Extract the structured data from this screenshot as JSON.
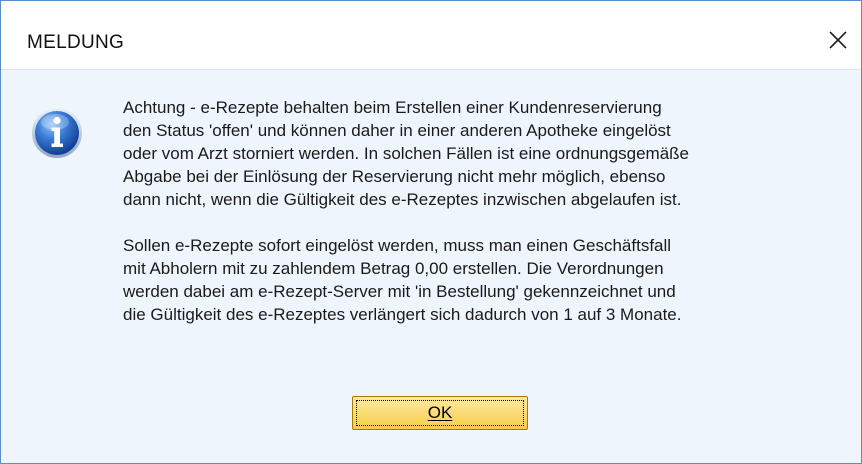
{
  "window": {
    "title": "MELDUNG",
    "close_icon": "close-icon"
  },
  "message": {
    "icon": "info-icon",
    "paragraph1": "Achtung - e-Rezepte behalten beim Erstellen einer Kundenreservierung\nden Status 'offen' und können daher in einer anderen Apotheke eingelöst\noder vom Arzt storniert werden. In solchen Fällen ist eine ordnungsgemäße\nAbgabe bei der Einlösung der Reservierung nicht mehr möglich, ebenso\ndann nicht, wenn die Gültigkeit des e-Rezeptes inzwischen abgelaufen ist.",
    "paragraph2": "Sollen e-Rezepte sofort eingelöst werden, muss man einen Geschäftsfall\nmit Abholern mit zu zahlendem Betrag 0,00 erstellen. Die Verordnungen\nwerden dabei am e-Rezept-Server mit 'in Bestellung' gekennzeichnet und\ndie Gültigkeit des e-Rezeptes verlängert sich dadurch von 1 auf 3 Monate."
  },
  "buttons": {
    "ok_label": "OK"
  },
  "colors": {
    "titlebar": "#ffffff",
    "body": "#eef5fc",
    "border": "#5a8ec8",
    "button": "#f5cd4e"
  }
}
